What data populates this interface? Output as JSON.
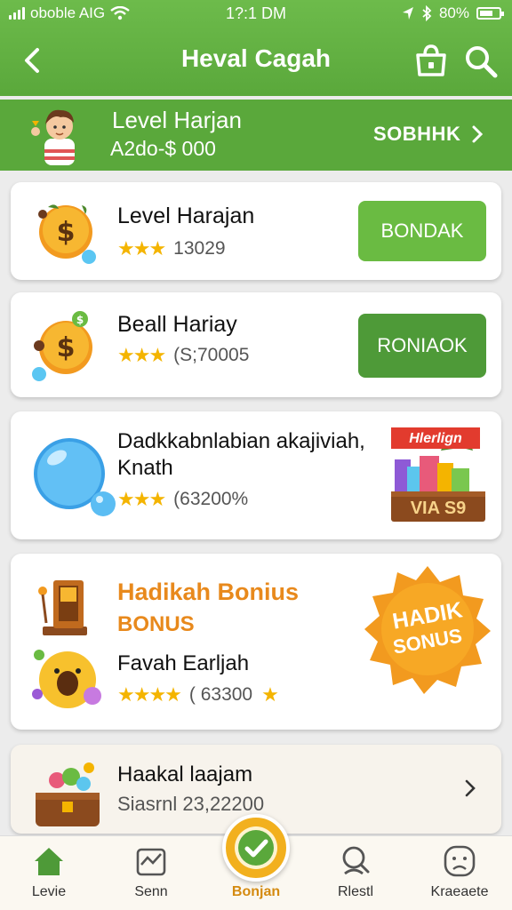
{
  "status_bar": {
    "carrier": "oboble AIG",
    "time": "1?:1 DM",
    "battery": "80%"
  },
  "header": {
    "title": "Heval Cagah"
  },
  "banner": {
    "title": "Level Harjan",
    "subtitle": "A2do-$ 000",
    "link": "SOBHHK"
  },
  "items": [
    {
      "title": "Level Harajan",
      "stars": "★★★",
      "rating_text": "13029",
      "button": "BONDAK",
      "button_color": "#6abb42"
    },
    {
      "title": "Beall Hariay",
      "stars": "★★★",
      "rating_text": "(S;70005",
      "button": "RONIAOK",
      "button_color": "#4e9a38"
    },
    {
      "title": "Dadkkabnlabian akajiviah,",
      "title2": "Knath",
      "stars": "★★★",
      "rating_text": "(63200%",
      "promo_top": "Hlerlign",
      "promo_bottom": "VIA S9"
    },
    {
      "title": "Hadikah Bonius",
      "subtitle": "BONUS",
      "title2": "Favah Earljah",
      "stars": "★★★★",
      "rating_text": "( 63300",
      "badge_line1": "HADIK",
      "badge_line2": "SONUS"
    },
    {
      "title": "Haakal laajam",
      "subtitle": "Siasrnl 23,22200"
    }
  ],
  "bottom_nav": [
    {
      "label": "Levie",
      "icon": "home-icon"
    },
    {
      "label": "Senn",
      "icon": "chart-icon"
    },
    {
      "label": "Bonjan",
      "icon": "check-icon"
    },
    {
      "label": "Rlestl",
      "icon": "search-icon"
    },
    {
      "label": "Kraeaete",
      "icon": "sad-face-icon"
    }
  ],
  "colors": {
    "brand_green": "#5aa83b",
    "accent_orange": "#e8891c",
    "star_gold": "#f4b400"
  }
}
